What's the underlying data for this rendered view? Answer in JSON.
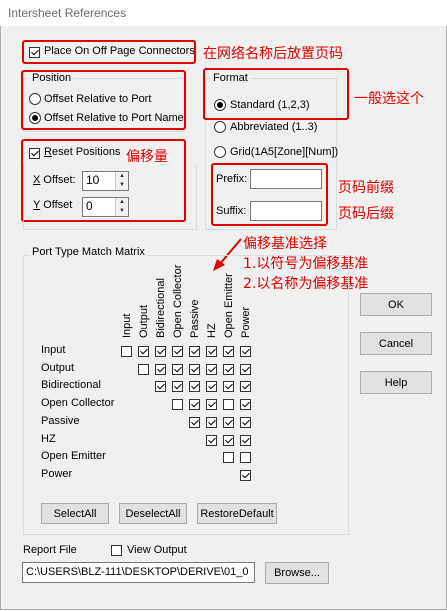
{
  "window": {
    "title": "Intersheet References"
  },
  "place_on_off_page": {
    "label": "Place On Off Page Connectors",
    "checked": true
  },
  "position": {
    "title": "Position",
    "options": [
      {
        "label": "Offset Relative to Port",
        "selected": false
      },
      {
        "label": "Offset Relative to Port Name",
        "selected": true
      }
    ]
  },
  "reset": {
    "label": "Reset Positions",
    "checked": true,
    "x_label": "X Offset:",
    "x_value": "10",
    "y_label": "Y Offset",
    "y_value": "0"
  },
  "format": {
    "title": "Format",
    "options": [
      {
        "label": "Standard (1,2,3)",
        "selected": true
      },
      {
        "label": "Abbreviated (1..3)",
        "selected": false
      },
      {
        "label": "Grid(1A5[Zone][Num])",
        "selected": false
      }
    ],
    "prefix_label": "Prefix:",
    "prefix_value": "",
    "suffix_label": "Suffix:",
    "suffix_value": ""
  },
  "matrix": {
    "title": "Port Type Match Matrix",
    "columns": [
      "Input",
      "Output",
      "Bidirectional",
      "Open Collector",
      "Passive",
      "HZ",
      "Open Emitter",
      "Power"
    ],
    "rows": [
      {
        "label": "Input",
        "cells": [
          false,
          true,
          true,
          true,
          true,
          true,
          true,
          true
        ]
      },
      {
        "label": "Output",
        "cells": [
          null,
          false,
          true,
          true,
          true,
          true,
          true,
          true
        ]
      },
      {
        "label": "Bidirectional",
        "cells": [
          null,
          null,
          true,
          true,
          true,
          true,
          true,
          true
        ]
      },
      {
        "label": "Open Collector",
        "cells": [
          null,
          null,
          null,
          false,
          true,
          true,
          false,
          true
        ]
      },
      {
        "label": "Passive",
        "cells": [
          null,
          null,
          null,
          null,
          true,
          true,
          true,
          true
        ]
      },
      {
        "label": "HZ",
        "cells": [
          null,
          null,
          null,
          null,
          null,
          true,
          true,
          true
        ]
      },
      {
        "label": "Open Emitter",
        "cells": [
          null,
          null,
          null,
          null,
          null,
          null,
          false,
          false
        ]
      },
      {
        "label": "Power",
        "cells": [
          null,
          null,
          null,
          null,
          null,
          null,
          null,
          true
        ]
      }
    ],
    "select_all": "SelectAll",
    "deselect_all": "DeselectAll",
    "restore_default": "RestoreDefault"
  },
  "buttons": {
    "ok": "OK",
    "cancel": "Cancel",
    "help": "Help"
  },
  "report": {
    "label": "Report File",
    "view_output_label": "View Output",
    "view_output_checked": false,
    "path": "C:\\USERS\\BLZ-111\\DESKTOP\\DERIVE\\01_0",
    "browse": "Browse..."
  },
  "annotations": {
    "place_note": "在网络名称后放置页码",
    "format_note": "一般选这个",
    "offset_note": "偏移量",
    "prefix_note": "页码前缀",
    "suffix_note": "页码后缀",
    "basis_title": "偏移基准选择",
    "basis_1": "1.以符号为偏移基准",
    "basis_2": "2.以名称为偏移基准"
  },
  "colors": {
    "annotation": "#e00000",
    "window_bg": "#f0f0f0"
  }
}
